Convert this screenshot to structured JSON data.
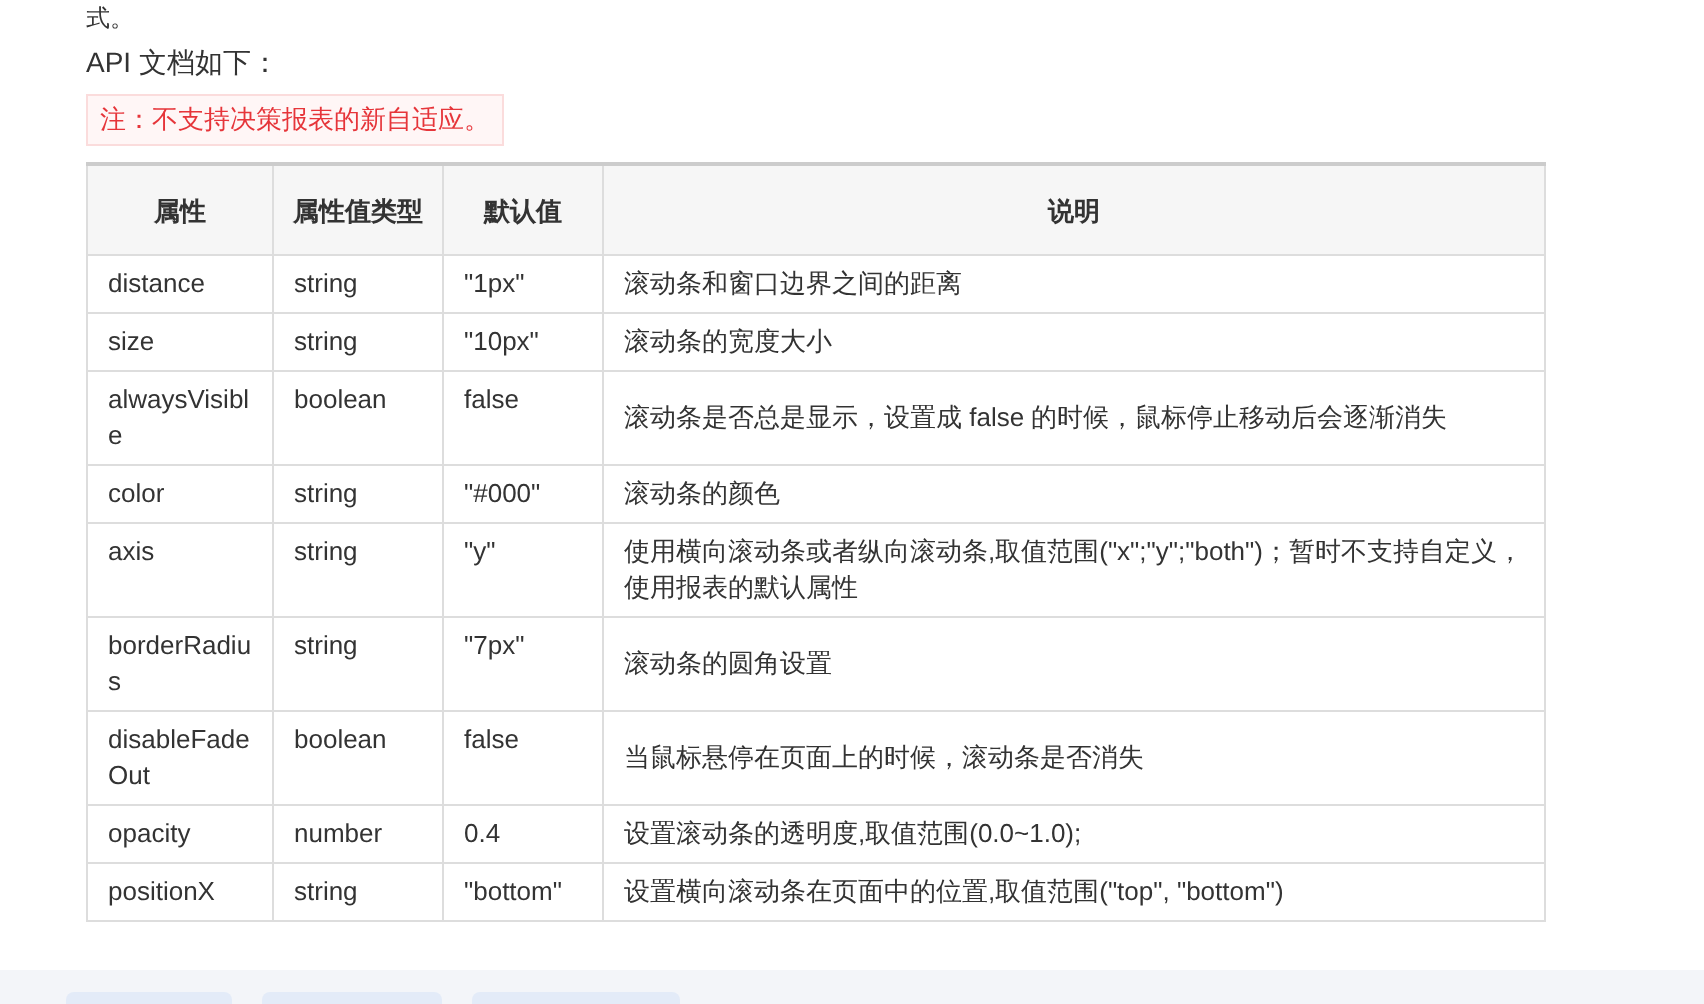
{
  "top_text": "式。",
  "intro": "API 文档如下：",
  "note": "注：不支持决策报表的新自适应。",
  "table": {
    "columns": [
      "属性",
      "属性值类型",
      "默认值",
      "说明"
    ],
    "rows": [
      [
        "distance",
        "string",
        "\"1px\"",
        "滚动条和窗口边界之间的距离"
      ],
      [
        "size",
        "string",
        "\"10px\"",
        "滚动条的宽度大小"
      ],
      [
        "alwaysVisible",
        "boolean",
        "false",
        "滚动条是否总是显示，设置成 false 的时候，鼠标停止移动后会逐渐消失"
      ],
      [
        "color",
        "string",
        "\"#000\"",
        "滚动条的颜色"
      ],
      [
        "axis",
        "string",
        "\"y\"",
        "使用横向滚动条或者纵向滚动条,取值范围(\"x\";\"y\";\"both\")；暂时不支持自定义，使用报表的默认属性"
      ],
      [
        "borderRadius",
        "string",
        "\"7px\"",
        "滚动条的圆角设置"
      ],
      [
        "disableFadeOut",
        "boolean",
        "false",
        "当鼠标悬停在页面上的时候，滚动条是否消失"
      ],
      [
        "opacity",
        "number",
        "0.4",
        "设置滚动条的透明度,取值范围(0.0~1.0);"
      ],
      [
        "positionX",
        "string",
        "\"bottom\"",
        "设置横向滚动条在页面中的位置,取值范围(\"top\", \"bottom\")"
      ]
    ]
  }
}
